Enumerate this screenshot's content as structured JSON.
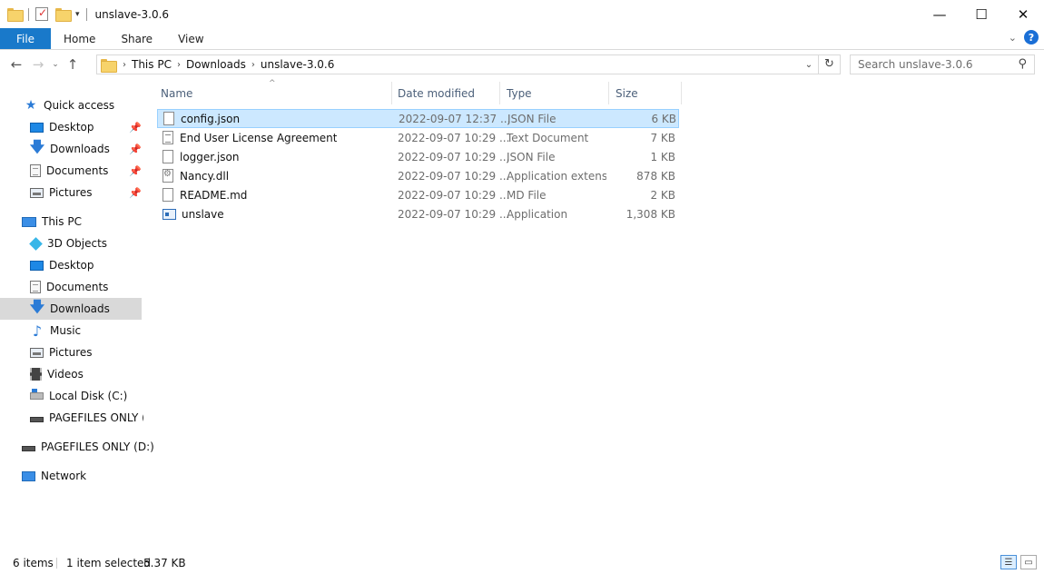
{
  "window": {
    "title": "unslave-3.0.6",
    "controls": {
      "minimize": "—",
      "maximize": "☐",
      "close": "✕"
    },
    "quick_access_dropdown": "▾"
  },
  "ribbon": {
    "tabs": [
      {
        "label": "File"
      },
      {
        "label": "Home"
      },
      {
        "label": "Share"
      },
      {
        "label": "View"
      }
    ],
    "expand_glyph": "⌄",
    "help_glyph": "?"
  },
  "navigation": {
    "back": "←",
    "forward": "→",
    "recent": "⌄",
    "up": "↑",
    "breadcrumbs": [
      "This PC",
      "Downloads",
      "unslave-3.0.6"
    ],
    "crumb_separator": "›",
    "dropdown": "⌄",
    "refresh": "↻"
  },
  "search": {
    "placeholder": "Search unslave-3.0.6",
    "icon": "search-icon",
    "glyph": "⚲"
  },
  "sidebar": {
    "quick_access": {
      "label": "Quick access"
    },
    "pinned": [
      {
        "label": "Desktop",
        "icon": "desktop-icon"
      },
      {
        "label": "Downloads",
        "icon": "downloads-icon"
      },
      {
        "label": "Documents",
        "icon": "documents-icon"
      },
      {
        "label": "Pictures",
        "icon": "pictures-icon"
      }
    ],
    "this_pc": {
      "label": "This PC"
    },
    "this_pc_items": [
      {
        "label": "3D Objects",
        "icon": "3d-objects-icon"
      },
      {
        "label": "Desktop",
        "icon": "desktop-icon"
      },
      {
        "label": "Documents",
        "icon": "documents-icon"
      },
      {
        "label": "Downloads",
        "icon": "downloads-icon",
        "selected": true
      },
      {
        "label": "Music",
        "icon": "music-icon"
      },
      {
        "label": "Pictures",
        "icon": "pictures-icon"
      },
      {
        "label": "Videos",
        "icon": "videos-icon"
      },
      {
        "label": "Local Disk (C:)",
        "icon": "local-disk-icon"
      },
      {
        "label": "PAGEFILES ONLY (D",
        "icon": "drive-icon"
      }
    ],
    "drive_root": {
      "label": "PAGEFILES ONLY (D:)"
    },
    "network": {
      "label": "Network"
    }
  },
  "file_list": {
    "columns": {
      "name": "Name",
      "date": "Date modified",
      "type": "Type",
      "size": "Size"
    },
    "sort_indicator": "^",
    "rows": [
      {
        "name": "config.json",
        "date": "2022-09-07 12:37 ...",
        "type": "JSON File",
        "size": "6 KB",
        "icon": "file-icon",
        "selected": true
      },
      {
        "name": "End User License Agreement",
        "date": "2022-09-07 10:29 ...",
        "type": "Text Document",
        "size": "7 KB",
        "icon": "text-file-icon"
      },
      {
        "name": "logger.json",
        "date": "2022-09-07 10:29 ...",
        "type": "JSON File",
        "size": "1 KB",
        "icon": "file-icon"
      },
      {
        "name": "Nancy.dll",
        "date": "2022-09-07 10:29 ...",
        "type": "Application extens...",
        "size": "878 KB",
        "icon": "dll-file-icon"
      },
      {
        "name": "README.md",
        "date": "2022-09-07 10:29 ...",
        "type": "MD File",
        "size": "2 KB",
        "icon": "file-icon"
      },
      {
        "name": "unslave",
        "date": "2022-09-07 10:29 ...",
        "type": "Application",
        "size": "1,308 KB",
        "icon": "application-icon"
      }
    ]
  },
  "status_bar": {
    "item_count": "6 items",
    "selection": "1 item selected",
    "selection_size": "5.37 KB"
  },
  "colors": {
    "accent": "#1979ca",
    "selection": "#cce8ff",
    "selection_border": "#99d1ff",
    "sidebar_selected": "#d9d9d9"
  }
}
